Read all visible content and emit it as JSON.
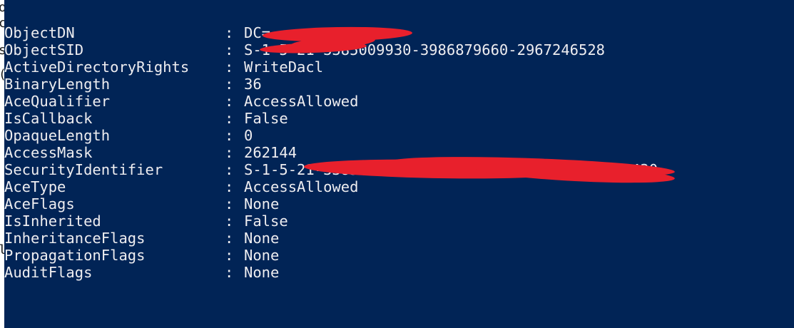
{
  "window": {
    "background": "#012456",
    "text_color": "#eeedf0",
    "redaction_color": "#e8202c"
  },
  "left_fragments": [
    "o",
    "c",
    "s",
    "(",
    "l"
  ],
  "separator": ":",
  "properties": [
    {
      "name": "ObjectDN",
      "value": "DC="
    },
    {
      "name": "ObjectSID",
      "value": "S-1-5-21-3385009930-3986879660-2967246528"
    },
    {
      "name": "ActiveDirectoryRights",
      "value": "WriteDacl"
    },
    {
      "name": "BinaryLength",
      "value": "36"
    },
    {
      "name": "AceQualifier",
      "value": "AccessAllowed"
    },
    {
      "name": "IsCallback",
      "value": "False"
    },
    {
      "name": "OpaqueLength",
      "value": "0"
    },
    {
      "name": "AccessMask",
      "value": "262144"
    },
    {
      "name": "SecurityIdentifier",
      "value": "S-1-5-21-3385009930-3986879660-2967246528-11430"
    },
    {
      "name": "AceType",
      "value": "AccessAllowed"
    },
    {
      "name": "AceFlags",
      "value": "None"
    },
    {
      "name": "IsInherited",
      "value": "False"
    },
    {
      "name": "InheritanceFlags",
      "value": "None"
    },
    {
      "name": "PropagationFlags",
      "value": "None"
    },
    {
      "name": "AuditFlags",
      "value": "None"
    }
  ]
}
